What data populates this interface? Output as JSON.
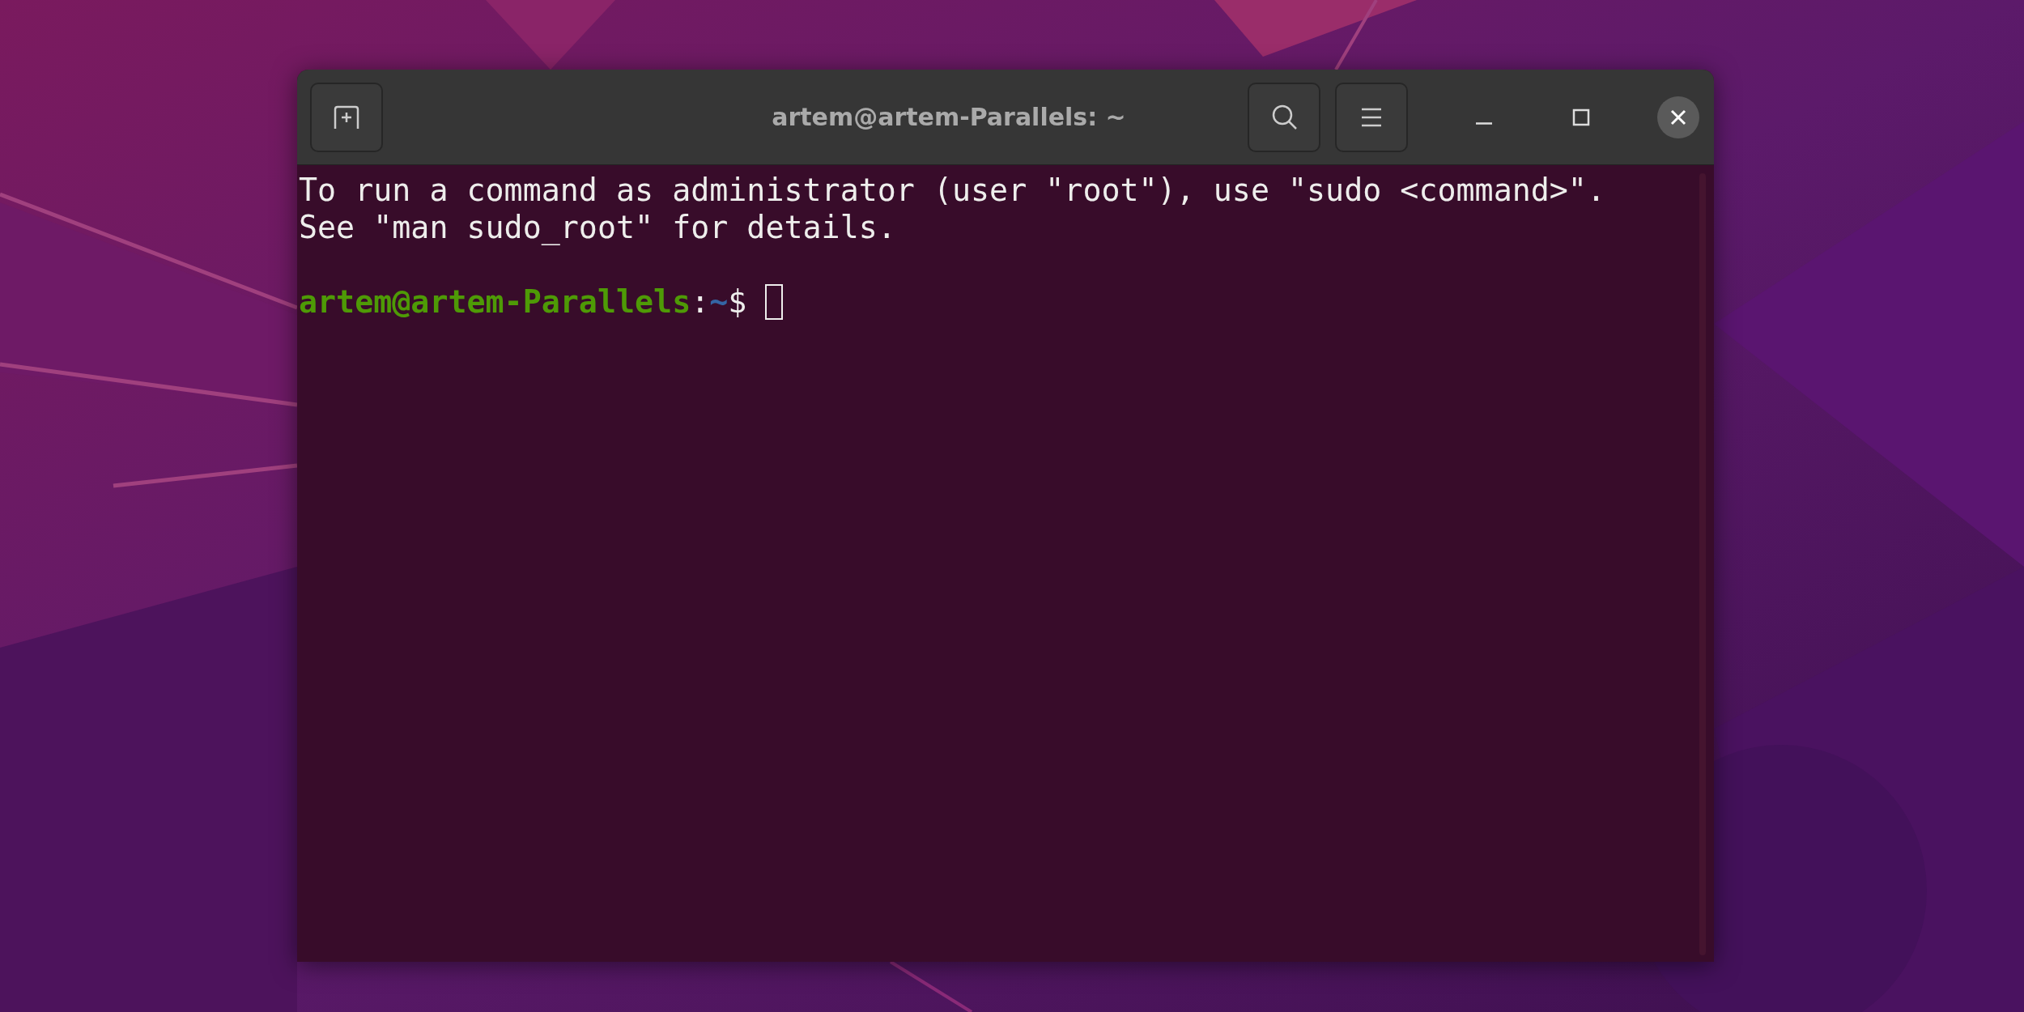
{
  "window": {
    "title": "artem@artem-Parallels: ~"
  },
  "terminal": {
    "lines": [
      "To run a command as administrator (user \"root\"), use \"sudo <command>\".",
      "See \"man sudo_root\" for details."
    ],
    "prompt": {
      "user_host": "artem@artem-Parallels",
      "separator": ":",
      "path": "~",
      "symbol": "$"
    }
  }
}
